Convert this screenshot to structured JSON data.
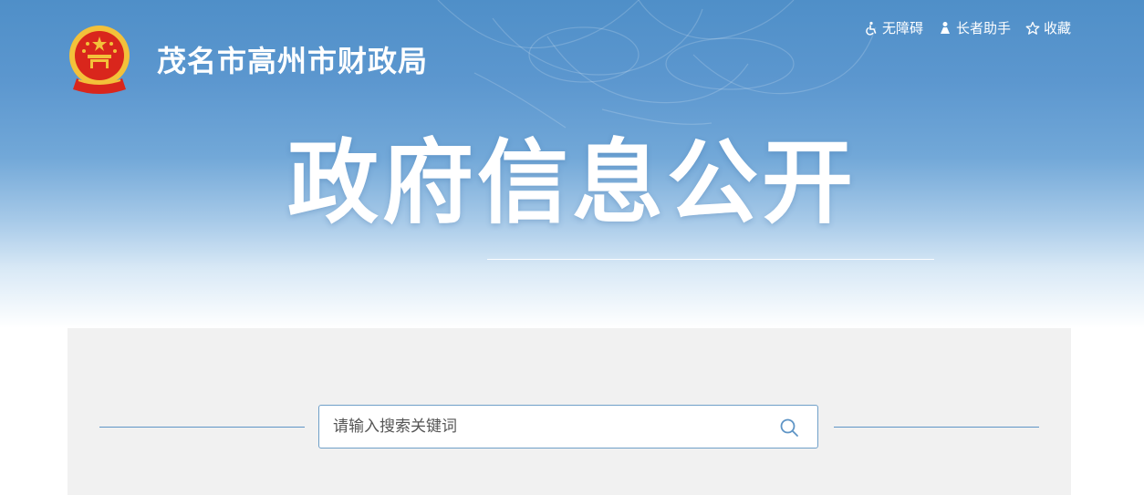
{
  "header": {
    "site_title": "茂名市高州市财政局",
    "emblem_icon": "national-emblem-icon",
    "links": [
      {
        "label": "无障碍",
        "icon": "wheelchair-icon"
      },
      {
        "label": "长者助手",
        "icon": "elder-helper-icon"
      },
      {
        "label": "收藏",
        "icon": "star-outline-icon"
      }
    ]
  },
  "hero": {
    "title": "政府信息公开"
  },
  "search": {
    "placeholder": "请输入搜索关键词",
    "icon": "search-icon"
  },
  "colors": {
    "header_blue": "#4f8fc8",
    "search_border": "#6f9fc8",
    "content_bg": "#f1f1f1",
    "emblem_red": "#d9261c",
    "emblem_gold": "#f3c13a"
  }
}
